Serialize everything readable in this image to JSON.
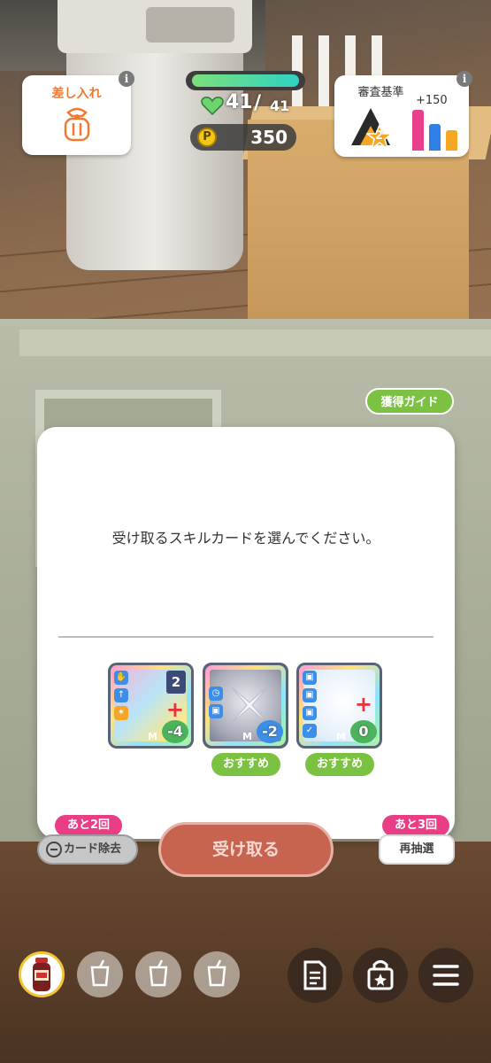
{
  "hud": {
    "gift": {
      "label": "差し入れ",
      "info": "i"
    },
    "stamina": {
      "current": "41",
      "sep": "/",
      "max": "41",
      "fill_fraction": 1.0
    },
    "points": {
      "icon_letter": "P",
      "value": "350"
    },
    "criteria": {
      "label": "審査基準",
      "bonus": "+150",
      "rank": "2",
      "info": "i",
      "bars": [
        {
          "color": "#e8408c",
          "level": 1.0
        },
        {
          "color": "#2f7fe6",
          "level": 0.66
        },
        {
          "color": "#f5a623",
          "level": 0.5
        }
      ]
    }
  },
  "guide_button": "獲得ガイド",
  "dialog": {
    "message": "受け取るスキルカードを選んでください。",
    "cards": [
      {
        "name": "card-1",
        "cost_top": "2",
        "cost_bottom": "-4",
        "bottom_color": "#4bb35c",
        "recommended": ""
      },
      {
        "name": "card-2",
        "cost_top": "",
        "cost_bottom": "-2",
        "bottom_color": "#3d8ee6",
        "recommended": "おすすめ"
      },
      {
        "name": "card-3",
        "cost_top": "",
        "cost_bottom": "0",
        "bottom_color": "#4bb35c",
        "recommended": "おすすめ"
      }
    ],
    "card_mark": "M"
  },
  "actions": {
    "remove_remaining": "あと2回",
    "remove_label": "カード除去",
    "receive_label": "受け取る",
    "redraw_remaining": "あと3回",
    "redraw_label": "再抽選"
  },
  "bottom_bar": {
    "drink_slots": [
      "drink-slot-filled",
      "drink-slot-empty",
      "drink-slot-empty",
      "drink-slot-empty"
    ],
    "buttons": [
      "memo-icon",
      "shop-bag-icon",
      "menu-icon"
    ]
  }
}
